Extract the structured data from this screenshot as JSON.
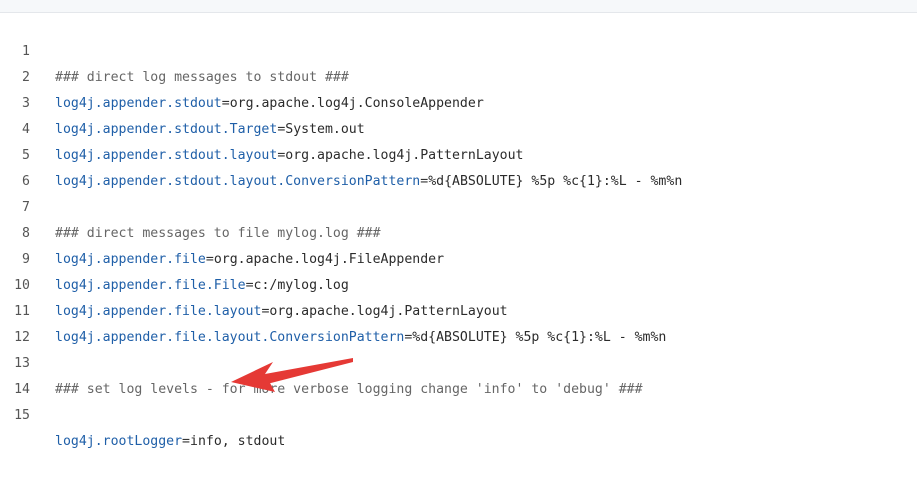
{
  "code_viewer": {
    "lines": [
      {
        "num": "1",
        "comment": "### direct log messages to stdout ###"
      },
      {
        "num": "2",
        "key": "log4j.appender.stdout",
        "eq": "=",
        "value": "org.apache.log4j.ConsoleAppender"
      },
      {
        "num": "3",
        "key": "log4j.appender.stdout.Target",
        "eq": "=",
        "value": "System.out"
      },
      {
        "num": "4",
        "key": "log4j.appender.stdout.layout",
        "eq": "=",
        "value": "org.apache.log4j.PatternLayout"
      },
      {
        "num": "5",
        "key": "log4j.appender.stdout.layout.ConversionPattern",
        "eq": "=",
        "value": "%d{ABSOLUTE} %5p %c{1}:%L - %m%n"
      },
      {
        "num": "6"
      },
      {
        "num": "7",
        "comment": "### direct messages to file mylog.log ###"
      },
      {
        "num": "8",
        "key": "log4j.appender.file",
        "eq": "=",
        "value": "org.apache.log4j.FileAppender"
      },
      {
        "num": "9",
        "key": "log4j.appender.file.File",
        "eq": "=",
        "value": "c:/mylog.log"
      },
      {
        "num": "10",
        "key": "log4j.appender.file.layout",
        "eq": "=",
        "value": "org.apache.log4j.PatternLayout"
      },
      {
        "num": "11",
        "key": "log4j.appender.file.layout.ConversionPattern",
        "eq": "=",
        "value": "%d{ABSOLUTE} %5p %c{1}:%L - %m%n"
      },
      {
        "num": "12"
      },
      {
        "num": "13",
        "comment": "### set log levels - for more verbose logging change 'info' to 'debug' ###"
      },
      {
        "num": "14"
      },
      {
        "num": "15",
        "key": "log4j.rootLogger",
        "eq": "=",
        "value": "info, stdout"
      }
    ]
  },
  "annotation": {
    "arrow_color": "#e53935",
    "icon": "red-arrow-icon"
  }
}
